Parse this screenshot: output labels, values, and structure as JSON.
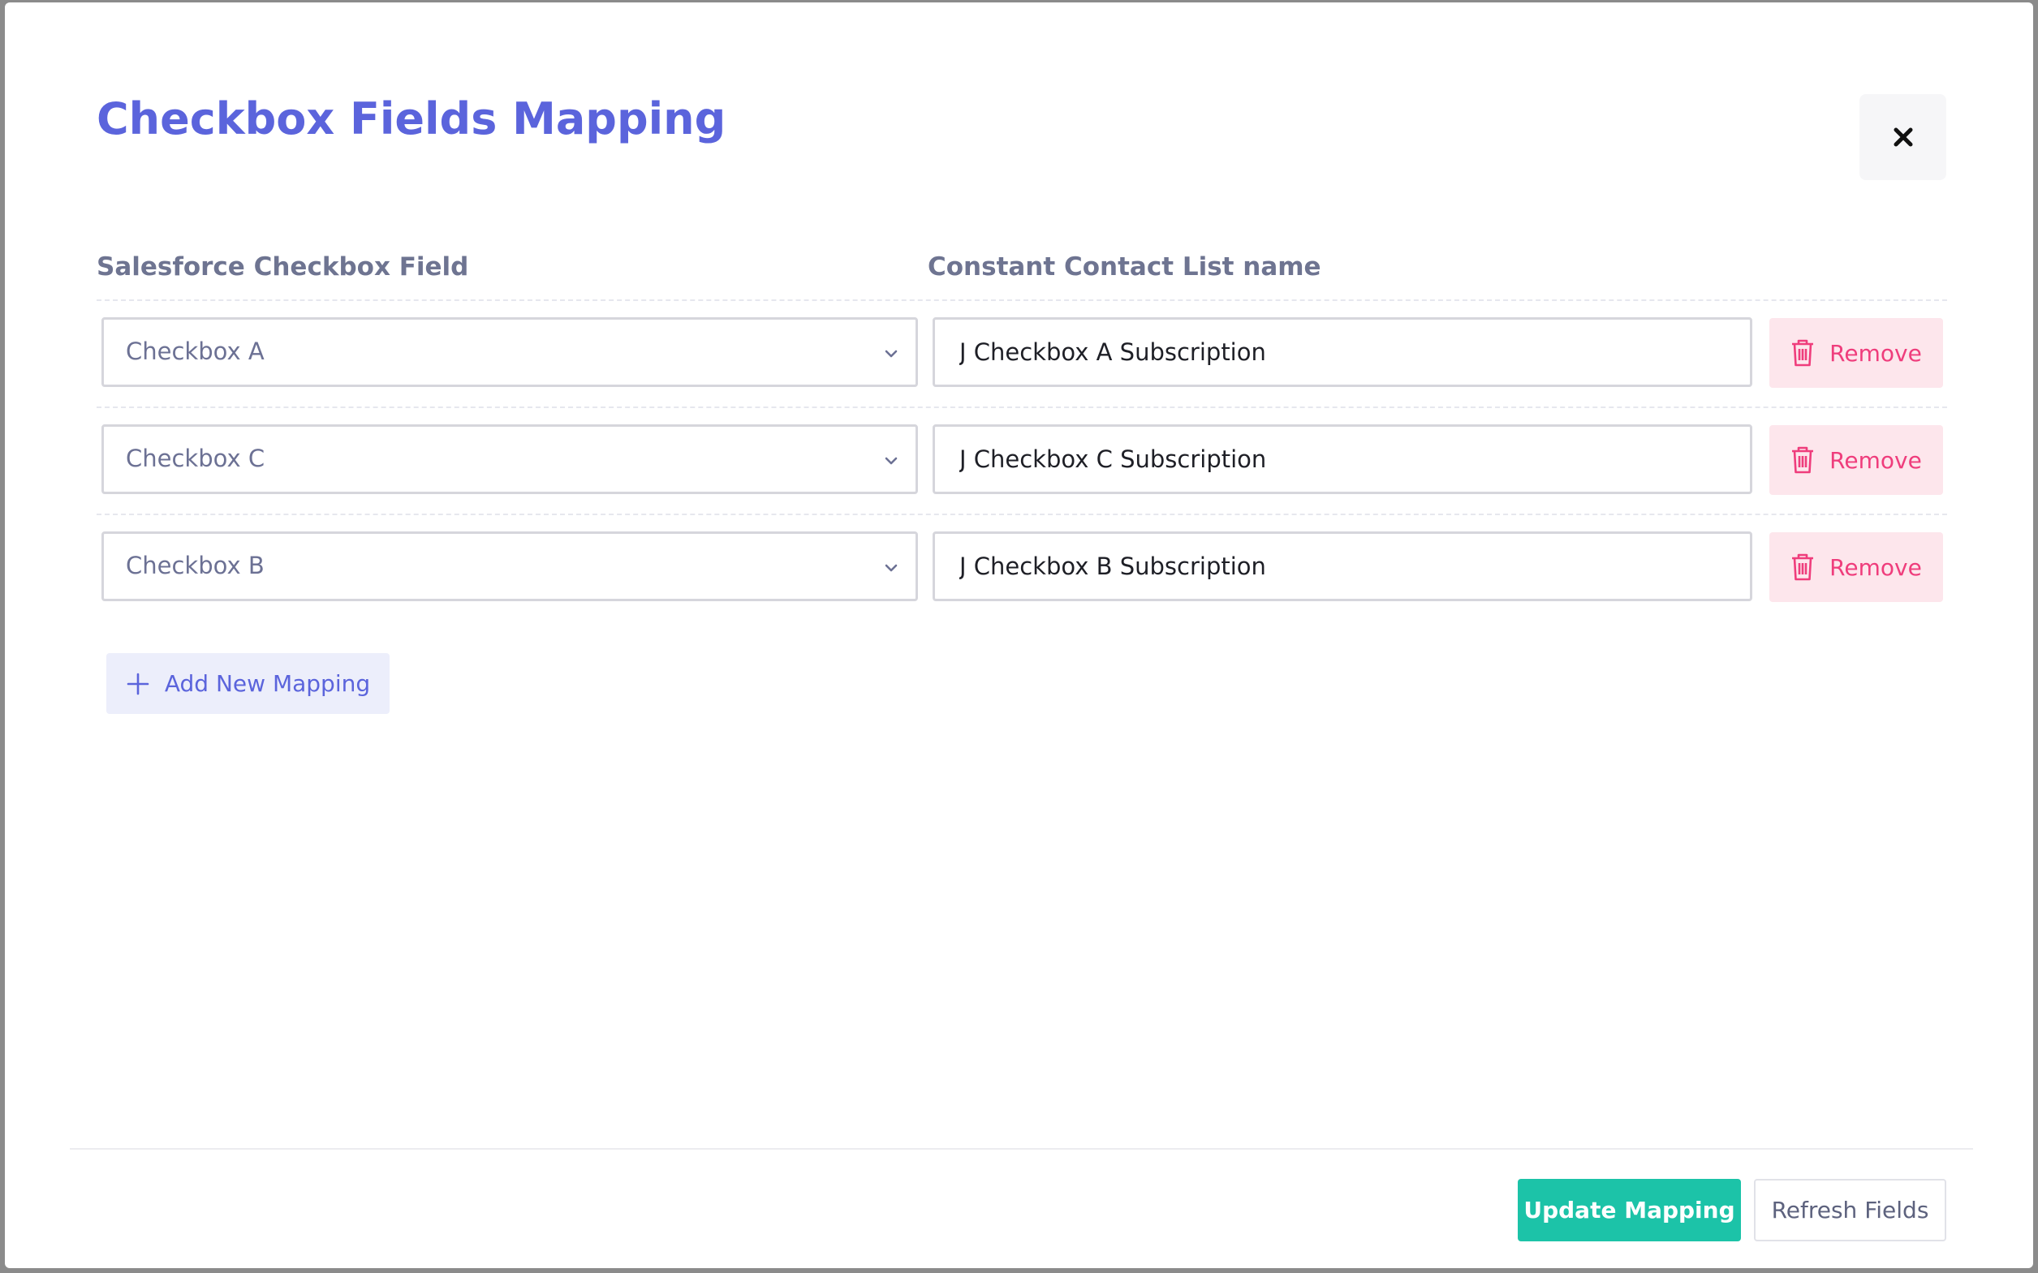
{
  "modal": {
    "title": "Checkbox Fields Mapping"
  },
  "columns": {
    "salesforce_field": "Salesforce Checkbox Field",
    "list_name": "Constant Contact List name"
  },
  "mappings": [
    {
      "salesforce_field": "Checkbox A",
      "list_name": "J Checkbox A Subscription",
      "remove_label": "Remove"
    },
    {
      "salesforce_field": "Checkbox C",
      "list_name": "J Checkbox C Subscription",
      "remove_label": "Remove"
    },
    {
      "salesforce_field": "Checkbox B",
      "list_name": "J Checkbox B Subscription",
      "remove_label": "Remove"
    }
  ],
  "actions": {
    "add_mapping": "Add New Mapping",
    "update_mapping": "Update Mapping",
    "refresh_fields": "Refresh Fields"
  },
  "icons": {
    "close": "close-icon",
    "dropdown": "chevron-down-icon",
    "remove": "trash-icon",
    "add": "plus-icon"
  },
  "colors": {
    "accent": "#5b64dc",
    "primary_button": "#1cc3a8",
    "danger": "#ef3d7c",
    "danger_bg": "#fde6ec"
  }
}
